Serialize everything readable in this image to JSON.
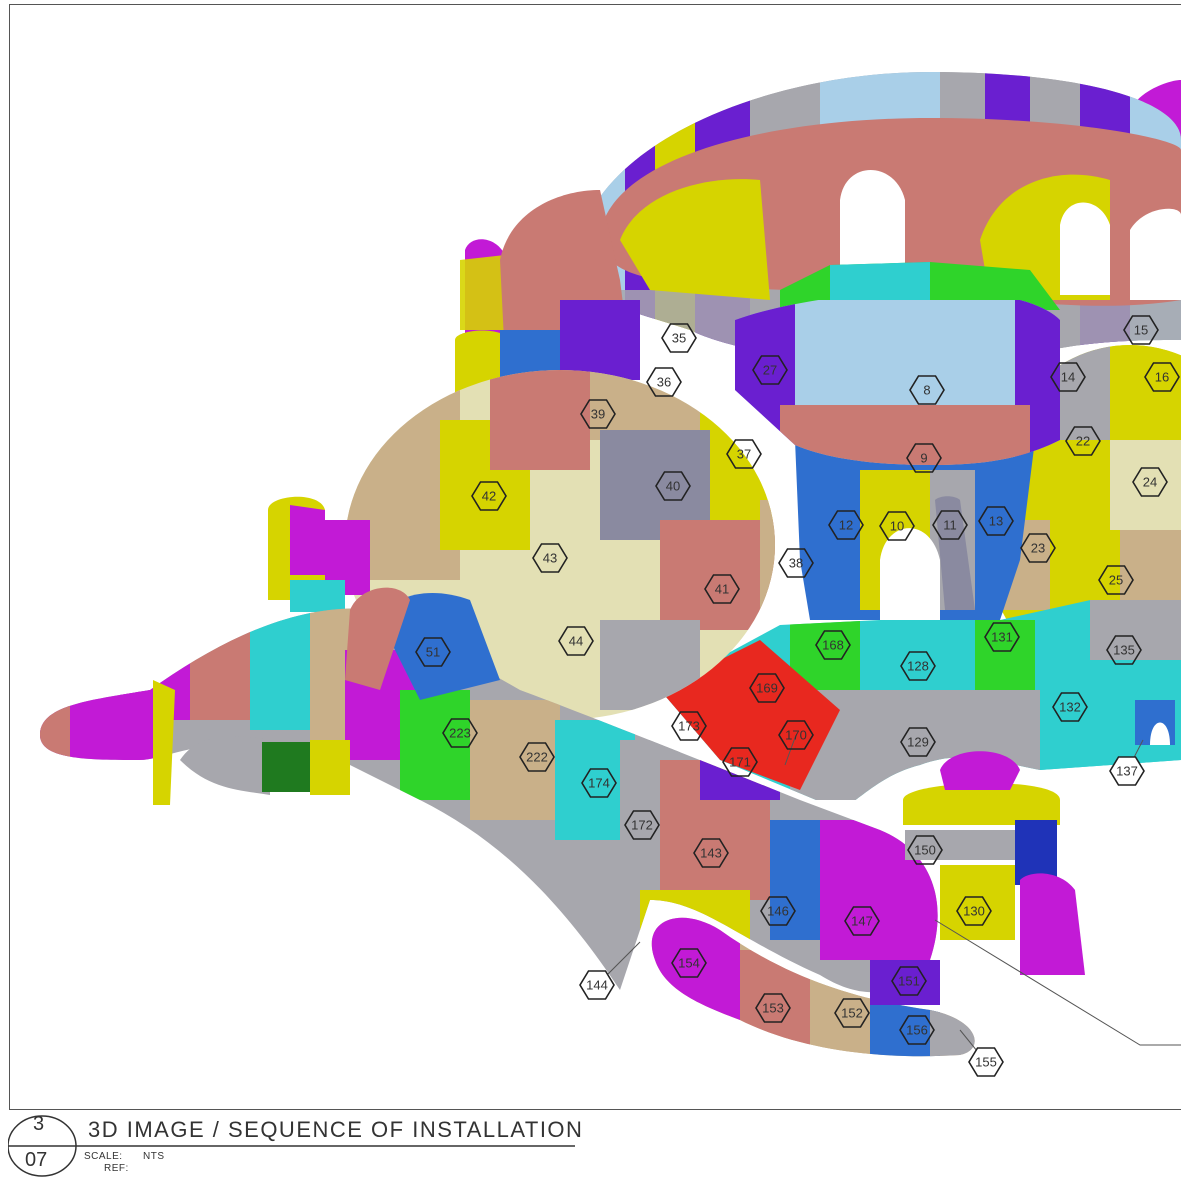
{
  "title_block": {
    "detail_number": "3",
    "sheet_number": "07",
    "title": "3D IMAGE / SEQUENCE OF INSTALLATION",
    "scale_label": "SCALE:",
    "scale_value": "NTS",
    "ref_label": "REF:"
  },
  "colors": {
    "purple": "#6a1fd0",
    "magenta": "#c21ad6",
    "grey": "#a7a7ad",
    "salmon": "#c97a73",
    "lightblue": "#a9cfe8",
    "blue": "#2f6fcf",
    "yellow": "#d6d400",
    "cream": "#e3e0b4",
    "tan": "#c9b089",
    "teal": "#2fcfcf",
    "green": "#2fd42a",
    "red": "#e8281f",
    "slate": "#8a8aa0",
    "white": "#ffffff"
  },
  "panel_tags": [
    {
      "label": "35"
    },
    {
      "label": "36"
    },
    {
      "label": "27"
    },
    {
      "label": "8"
    },
    {
      "label": "14"
    },
    {
      "label": "15"
    },
    {
      "label": "16"
    },
    {
      "label": "39"
    },
    {
      "label": "37"
    },
    {
      "label": "9"
    },
    {
      "label": "22"
    },
    {
      "label": "24"
    },
    {
      "label": "42"
    },
    {
      "label": "40"
    },
    {
      "label": "12"
    },
    {
      "label": "10"
    },
    {
      "label": "11"
    },
    {
      "label": "13"
    },
    {
      "label": "23"
    },
    {
      "label": "43"
    },
    {
      "label": "38"
    },
    {
      "label": "25"
    },
    {
      "label": "41"
    },
    {
      "label": "44"
    },
    {
      "label": "51"
    },
    {
      "label": "168"
    },
    {
      "label": "128"
    },
    {
      "label": "131"
    },
    {
      "label": "135"
    },
    {
      "label": "169"
    },
    {
      "label": "132"
    },
    {
      "label": "173"
    },
    {
      "label": "223"
    },
    {
      "label": "222"
    },
    {
      "label": "170"
    },
    {
      "label": "129"
    },
    {
      "label": "171"
    },
    {
      "label": "137"
    },
    {
      "label": "174"
    },
    {
      "label": "172"
    },
    {
      "label": "143"
    },
    {
      "label": "150"
    },
    {
      "label": "146"
    },
    {
      "label": "147"
    },
    {
      "label": "130"
    },
    {
      "label": "154"
    },
    {
      "label": "144"
    },
    {
      "label": "151"
    },
    {
      "label": "153"
    },
    {
      "label": "152"
    },
    {
      "label": "156"
    },
    {
      "label": "155"
    }
  ]
}
